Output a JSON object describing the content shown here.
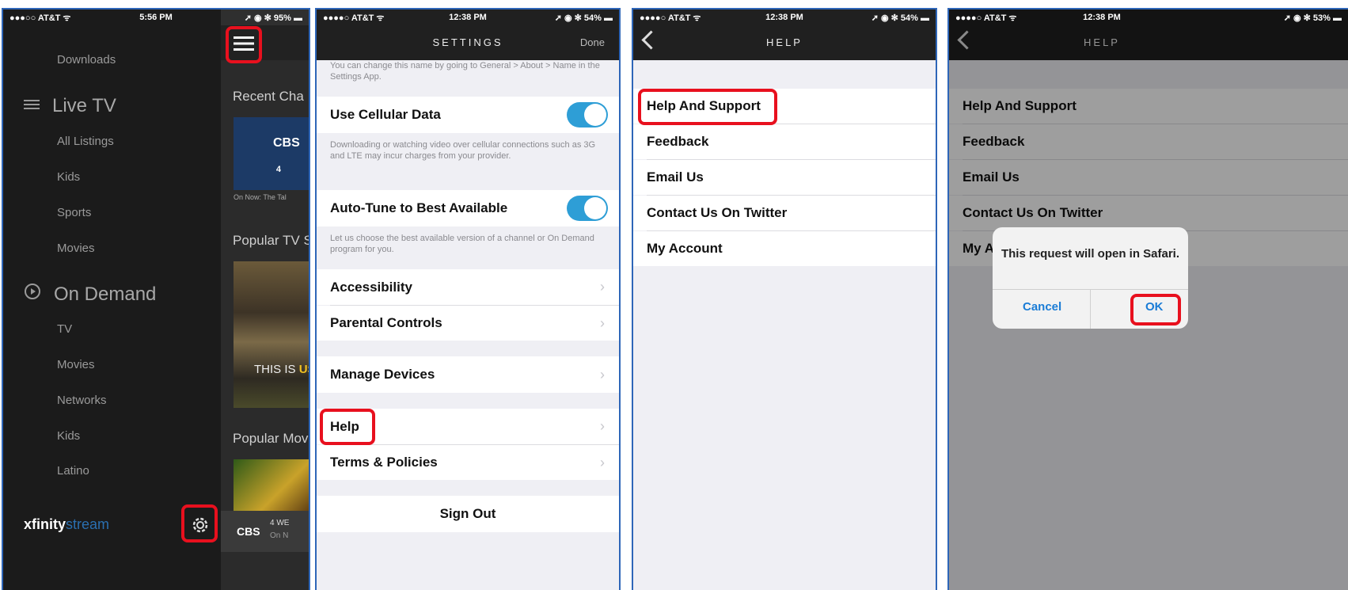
{
  "phone1": {
    "status": {
      "carrier": "●●●○○ AT&T ᯤ",
      "time": "5:56 PM",
      "right": "➚ ◉ ✻ 95% ▬"
    },
    "menu": {
      "downloads": "Downloads",
      "live_tv": "Live TV",
      "live_items": [
        "All Listings",
        "Kids",
        "Sports",
        "Movies"
      ],
      "on_demand": "On Demand",
      "od_items": [
        "TV",
        "Movies",
        "Networks",
        "Kids",
        "Latino"
      ],
      "brand_a": "xfinity",
      "brand_b": "stream"
    },
    "content": {
      "recent": "Recent Cha",
      "cbs": "CBS",
      "cbs_num": "4",
      "on_now": "On Now: The Tal",
      "popular_tv": "Popular TV S",
      "this_is": "THIS IS ",
      "us": "US",
      "popular_mov": "Popular Mov",
      "bottom_cbs": "CBS",
      "bottom_4we": "4 WE",
      "bottom_on": "On N"
    }
  },
  "phone2": {
    "status": {
      "carrier": "●●●●○ AT&T ᯤ",
      "time": "12:38 PM",
      "right": "➚ ◉ ✻ 54% ▬"
    },
    "title": "SETTINGS",
    "done": "Done",
    "top_note": "You can change this name by going to General > About > Name in the Settings App.",
    "cellular": "Use Cellular Data",
    "cellular_note": "Downloading or watching video over cellular connections such as 3G and LTE may incur charges from your provider.",
    "autotune": "Auto-Tune to Best Available",
    "autotune_note": "Let us choose the best available version of a channel or On Demand program for you.",
    "accessibility": "Accessibility",
    "parental": "Parental Controls",
    "manage": "Manage Devices",
    "help": "Help",
    "terms": "Terms & Policies",
    "signout": "Sign Out"
  },
  "phone3": {
    "status": {
      "carrier": "●●●●○ AT&T ᯤ",
      "time": "12:38 PM",
      "right": "➚ ◉ ✻ 54% ▬"
    },
    "title": "HELP",
    "items": [
      "Help And Support",
      "Feedback",
      "Email Us",
      "Contact Us On Twitter",
      "My Account"
    ]
  },
  "phone4": {
    "status": {
      "carrier": "●●●●○ AT&T ᯤ",
      "time": "12:38 PM",
      "right": "➚ ◉ ✻ 53% ▬"
    },
    "title": "HELP",
    "items": [
      "Help And Support",
      "Feedback",
      "Email Us",
      "Contact Us On Twitter",
      "My A"
    ],
    "alert_msg": "This request will open in Safari.",
    "cancel": "Cancel",
    "ok": "OK"
  }
}
